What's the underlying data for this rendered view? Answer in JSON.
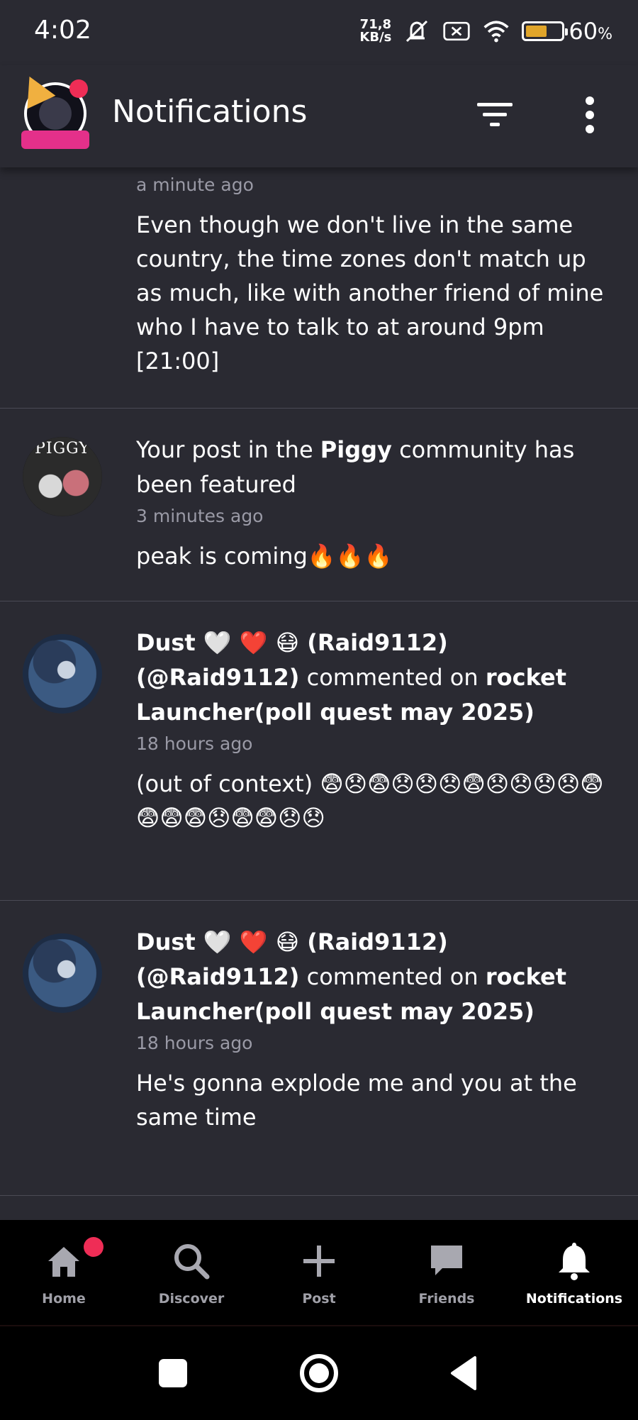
{
  "status_bar": {
    "time": "4:02",
    "net_speed_value": "71,8",
    "net_speed_unit": "KB/s",
    "battery_percent": "60",
    "battery_symbol": "%",
    "battery_level": 0.6
  },
  "header": {
    "title": "Notifications"
  },
  "notifications": [
    {
      "time": "a minute ago",
      "text": "Even though we don't live in the same country, the time zones don't match up as much, like with another friend of mine who I have to talk to at around 9pm [21:00]"
    },
    {
      "avatar_label": "PIGGY",
      "headline_prefix": "Your post in the ",
      "headline_bold": "Piggy",
      "headline_suffix": " community has been featured",
      "time": "3 minutes ago",
      "text": "peak is coming🔥🔥🔥"
    },
    {
      "author": "Dust 🤍 ❤️ 😷 (Raid9112) (@Raid9112)",
      "action": " commented on ",
      "post_title": "rocket Launcher(poll quest may 2025)",
      "time": "18 hours ago",
      "text": "(out of context) 😨😞😨😞😞😞😨😞😞😞😞😨 😨😨😨😞😨😨😞😞"
    },
    {
      "author": "Dust 🤍 ❤️ 😷 (Raid9112) (@Raid9112)",
      "action": " commented on ",
      "post_title": "rocket Launcher(poll quest may 2025)",
      "time": "18 hours ago",
      "text": "He's gonna explode me and you at the same time"
    }
  ],
  "bottom_nav": {
    "items": [
      {
        "label": "Home",
        "icon": "home-icon"
      },
      {
        "label": "Discover",
        "icon": "search-icon"
      },
      {
        "label": "Post",
        "icon": "plus-icon"
      },
      {
        "label": "Friends",
        "icon": "chat-icon"
      },
      {
        "label": "Notifications",
        "icon": "bell-icon"
      }
    ],
    "active": "Notifications"
  },
  "colors": {
    "background": "#2a2a32",
    "accent_badge": "#ef2d56",
    "muted_text": "#9a9aa6",
    "nav_background": "#000000",
    "battery_fill": "#e0a52a"
  }
}
